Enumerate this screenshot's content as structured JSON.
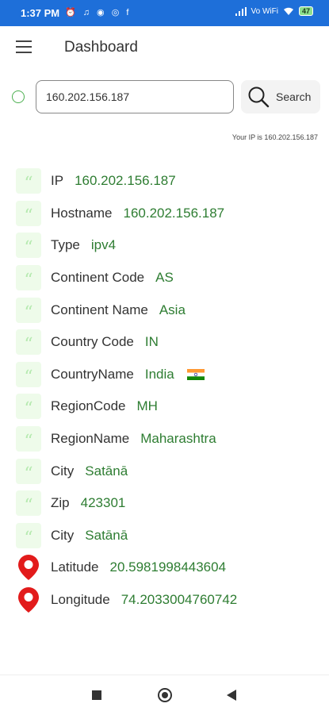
{
  "status": {
    "time": "1:37 PM",
    "left_icons": "⏰ ♫ ◉ ◎ f",
    "network": "Vo WiFi",
    "battery": "47"
  },
  "header": {
    "title": "Dashboard"
  },
  "search": {
    "input_value": "160.202.156.187",
    "button_label": "Search"
  },
  "your_ip": "Your IP is 160.202.156.187",
  "rows": [
    {
      "label": "IP",
      "value": "160.202.156.187",
      "icon": "quote-icon"
    },
    {
      "label": "Hostname",
      "value": "160.202.156.187",
      "icon": "quote-icon"
    },
    {
      "label": "Type",
      "value": "ipv4",
      "icon": "quote-icon"
    },
    {
      "label": "Continent Code",
      "value": "AS",
      "icon": "quote-icon"
    },
    {
      "label": "Continent Name",
      "value": "Asia",
      "icon": "quote-icon"
    },
    {
      "label": "Country Code",
      "value": "IN",
      "icon": "quote-icon"
    },
    {
      "label": "CountryName",
      "value": "India",
      "icon": "quote-icon",
      "flag": "india-flag-icon"
    },
    {
      "label": "RegionCode",
      "value": "MH",
      "icon": "quote-icon"
    },
    {
      "label": "RegionName",
      "value": "Maharashtra",
      "icon": "quote-icon"
    },
    {
      "label": "City",
      "value": "Satānā",
      "icon": "quote-icon"
    },
    {
      "label": "Zip",
      "value": "423301",
      "icon": "quote-icon"
    },
    {
      "label": "City",
      "value": "Satānā",
      "icon": "quote-icon"
    },
    {
      "label": "Latitude",
      "value": "20.5981998443604",
      "icon": "location-pin-icon"
    },
    {
      "label": "Longitude",
      "value": "74.2033004760742",
      "icon": "location-pin-icon"
    }
  ],
  "colors": {
    "status_bar": "#1e6fd9",
    "value_text": "#2e7d32",
    "quote_bg": "#eefbea",
    "pin": "#e21b1b"
  }
}
